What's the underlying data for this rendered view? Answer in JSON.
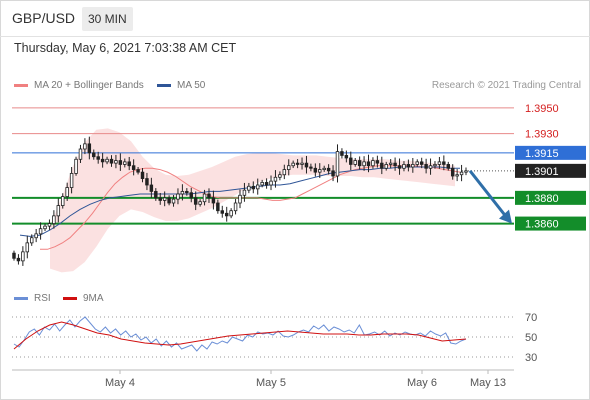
{
  "header": {
    "pair": "GBP/USD",
    "timeframe": "30 MIN",
    "datetime": "Thursday, May 6, 2021 7:03:38 AM CET"
  },
  "legend": {
    "ma20_label": "MA 20 + Bollinger Bands",
    "ma50_label": "MA 50",
    "credit": "Research © 2021 Trading Central",
    "rsi_label": "RSI",
    "rsi_ma_label": "9MA"
  },
  "colors": {
    "ma20": "#f08080",
    "ma50": "#2f5597",
    "band_fill": "#fadada",
    "resistance": "#e88a8a",
    "pivot": "#2f6fd6",
    "support": "#138d2a",
    "arrow": "#2f6fa8",
    "current_tag": "#222222",
    "rsi_line": "#6b8fd6",
    "rsi_ma": "#d01010"
  },
  "chart_data": [
    {
      "type": "candlestick",
      "x_labels": [
        "May 4",
        "May 5",
        "May 6",
        "May 13"
      ],
      "ylim": [
        1.382,
        1.396
      ],
      "levels": [
        {
          "value": "1.3950",
          "kind": "resistance"
        },
        {
          "value": "1.3930",
          "kind": "resistance"
        },
        {
          "value": "1.3915",
          "kind": "pivot"
        },
        {
          "value": "1.3901",
          "kind": "current"
        },
        {
          "value": "1.3880",
          "kind": "support"
        },
        {
          "value": "1.3860",
          "kind": "support"
        }
      ],
      "close": [
        1.3833,
        1.3831,
        1.3838,
        1.3845,
        1.3849,
        1.3852,
        1.3856,
        1.3858,
        1.386,
        1.3866,
        1.3874,
        1.3881,
        1.3888,
        1.3899,
        1.391,
        1.3918,
        1.3922,
        1.3915,
        1.3912,
        1.391,
        1.3908,
        1.391,
        1.3907,
        1.3909,
        1.3906,
        1.3908,
        1.3905,
        1.3902,
        1.39,
        1.3895,
        1.389,
        1.3885,
        1.388,
        1.3878,
        1.388,
        1.3876,
        1.3879,
        1.3883,
        1.3885,
        1.3884,
        1.388,
        1.3875,
        1.3877,
        1.3883,
        1.388,
        1.3876,
        1.387,
        1.3868,
        1.3866,
        1.387,
        1.3876,
        1.3882,
        1.3886,
        1.3889,
        1.3887,
        1.389,
        1.3892,
        1.389,
        1.3893,
        1.3896,
        1.3898,
        1.3902,
        1.3905,
        1.3907,
        1.3906,
        1.3907,
        1.3904,
        1.3903,
        1.39,
        1.3902,
        1.3903,
        1.3901,
        1.3897,
        1.3916,
        1.3913,
        1.3911,
        1.3906,
        1.3909,
        1.3905,
        1.3908,
        1.3905,
        1.3909,
        1.3907,
        1.3903,
        1.3906,
        1.3907,
        1.3905,
        1.3903,
        1.3906,
        1.3904,
        1.3906,
        1.3908,
        1.3906,
        1.3903,
        1.3905,
        1.3906,
        1.3908,
        1.3906,
        1.3903,
        1.3897,
        1.3898,
        1.39,
        1.3901
      ],
      "ma20": [
        1.384,
        1.384,
        1.3842,
        1.3845,
        1.3849,
        1.3855,
        1.3861,
        1.3868,
        1.3876,
        1.3884,
        1.3891,
        1.3896,
        1.39,
        1.3902,
        1.3903,
        1.3903,
        1.3902,
        1.39,
        1.3897,
        1.3893,
        1.3889,
        1.3886,
        1.3883,
        1.3881,
        1.388,
        1.388,
        1.388,
        1.388,
        1.388,
        1.388,
        1.3879,
        1.3878,
        1.3878,
        1.3879,
        1.388,
        1.3883,
        1.3886,
        1.3889,
        1.3892,
        1.3895,
        1.3898,
        1.39,
        1.3902,
        1.3903,
        1.3904,
        1.3905,
        1.3905,
        1.3905,
        1.3905,
        1.3905,
        1.3905,
        1.3904,
        1.3904,
        1.3903,
        1.3902,
        1.3901,
        1.39
      ],
      "ma50": [
        1.3851,
        1.385,
        1.3851,
        1.3855,
        1.386,
        1.3866,
        1.3871,
        1.3875,
        1.3878,
        1.388,
        1.3881,
        1.3882,
        1.3883,
        1.3883,
        1.3883,
        1.3883,
        1.3883,
        1.3883,
        1.3884,
        1.3885,
        1.3885,
        1.3886,
        1.3887,
        1.3888,
        1.3889,
        1.389,
        1.389,
        1.3891,
        1.3893,
        1.3895,
        1.3897,
        1.3899,
        1.39,
        1.3901,
        1.3902,
        1.3902,
        1.3903,
        1.3903,
        1.3904,
        1.3904,
        1.3904,
        1.3904,
        1.3904,
        1.3903,
        1.3903
      ],
      "bb_upper": [
        1.3858,
        1.388,
        1.3905,
        1.3923,
        1.3933,
        1.3934,
        1.3931,
        1.3924,
        1.3912,
        1.3903,
        1.3898,
        1.3897,
        1.3898,
        1.3901,
        1.3904,
        1.3908,
        1.3912,
        1.3914,
        1.3915,
        1.3915,
        1.3914,
        1.3913,
        1.3913,
        1.3913,
        1.3912,
        1.3911,
        1.391,
        1.391,
        1.391,
        1.391,
        1.3909,
        1.3909,
        1.3908,
        1.3907,
        1.3906,
        1.3905
      ],
      "bb_lower": [
        1.3825,
        1.3822,
        1.3823,
        1.383,
        1.3842,
        1.3856,
        1.3866,
        1.3871,
        1.3869,
        1.3865,
        1.3862,
        1.3862,
        1.3864,
        1.3868,
        1.3872,
        1.3877,
        1.3882,
        1.3888,
        1.3892,
        1.3895,
        1.3897,
        1.3898,
        1.3898,
        1.3898,
        1.3897,
        1.3897,
        1.3897,
        1.3896,
        1.3896,
        1.3895,
        1.3894,
        1.3893,
        1.3892,
        1.3891,
        1.389,
        1.3889
      ],
      "forecast": [
        1.3901,
        1.386
      ]
    },
    {
      "type": "line",
      "title": "RSI",
      "ylim": [
        25,
        75
      ],
      "y_ticks": [
        70,
        50,
        30
      ],
      "series": [
        {
          "name": "RSI",
          "values": [
            43,
            40,
            47,
            55,
            58,
            52,
            60,
            57,
            63,
            56,
            62,
            67,
            60,
            66,
            70,
            64,
            58,
            55,
            60,
            54,
            58,
            52,
            56,
            50,
            53,
            47,
            50,
            44,
            48,
            41,
            46,
            40,
            44,
            38,
            40,
            42,
            36,
            42,
            38,
            45,
            43,
            46,
            44,
            50,
            48,
            46,
            52,
            50,
            55,
            53,
            54,
            52,
            56,
            51,
            50,
            52,
            55,
            57,
            55,
            61,
            58,
            62,
            56,
            60,
            58,
            55,
            57,
            54,
            62,
            52,
            53,
            55,
            52,
            56,
            51,
            54,
            52,
            55,
            53,
            52,
            54,
            51,
            56,
            53,
            51,
            54,
            44,
            43,
            46,
            48
          ]
        },
        {
          "name": "9MA",
          "values": [
            38,
            48,
            56,
            62,
            65,
            62,
            58,
            54,
            52,
            48,
            46,
            44,
            43,
            42,
            43,
            45,
            47,
            49,
            51,
            52,
            53,
            54,
            55,
            56,
            55,
            54,
            53,
            53,
            53,
            52,
            52,
            53,
            53,
            53,
            52,
            49,
            46,
            47,
            48
          ]
        }
      ]
    }
  ]
}
